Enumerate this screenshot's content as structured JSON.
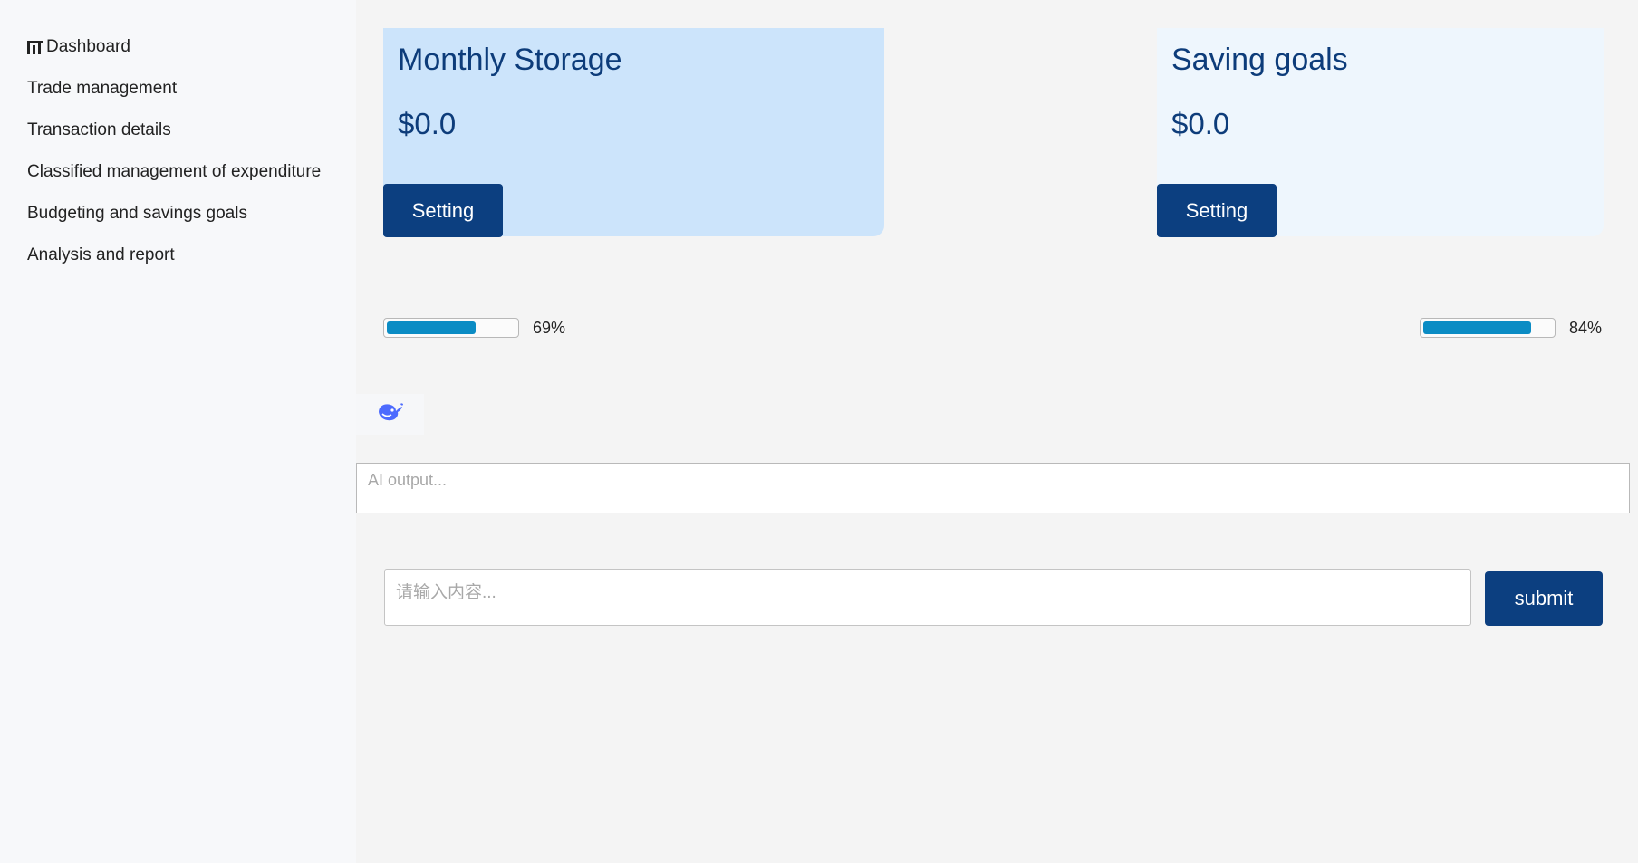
{
  "sidebar": {
    "items": [
      {
        "label": "Dashboard",
        "icon": "bar-chart-icon"
      },
      {
        "label": "Trade management"
      },
      {
        "label": "Transaction details"
      },
      {
        "label": "Classified management of expenditure"
      },
      {
        "label": "Budgeting and savings goals"
      },
      {
        "label": "Analysis and report"
      }
    ]
  },
  "cards": {
    "monthly": {
      "title": "Monthly Storage",
      "amount": "$0.0",
      "button_label": "Setting",
      "bg_color": "#cce4fb"
    },
    "saving": {
      "title": "Saving goals",
      "amount": "$0.0",
      "button_label": "Setting",
      "bg_color": "#eef6fd"
    }
  },
  "progress": {
    "monthly": {
      "percent": 69,
      "label": "69%"
    },
    "saving": {
      "percent": 84,
      "label": "84%"
    }
  },
  "ai": {
    "logo_icon": "whale-icon",
    "output_placeholder": "AI output...",
    "input_placeholder": "请输入内容...",
    "submit_label": "submit"
  },
  "colors": {
    "primary": "#0c3f80",
    "progress": "#0b8cc4",
    "title": "#0d3c7a",
    "logo": "#4d6bfe"
  }
}
